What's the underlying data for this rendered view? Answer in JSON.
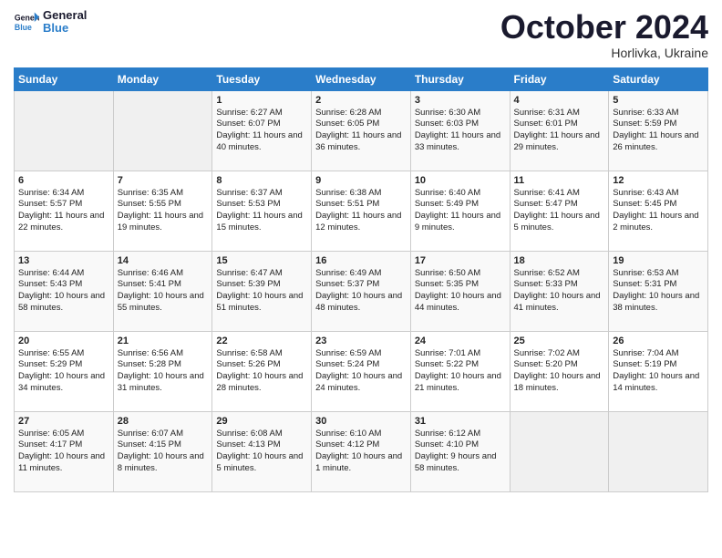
{
  "header": {
    "logo_line1": "General",
    "logo_line2": "Blue",
    "month": "October 2024",
    "location": "Horlivka, Ukraine"
  },
  "columns": [
    "Sunday",
    "Monday",
    "Tuesday",
    "Wednesday",
    "Thursday",
    "Friday",
    "Saturday"
  ],
  "weeks": [
    [
      {
        "day": "",
        "text": ""
      },
      {
        "day": "",
        "text": ""
      },
      {
        "day": "1",
        "text": "Sunrise: 6:27 AM\nSunset: 6:07 PM\nDaylight: 11 hours and 40 minutes."
      },
      {
        "day": "2",
        "text": "Sunrise: 6:28 AM\nSunset: 6:05 PM\nDaylight: 11 hours and 36 minutes."
      },
      {
        "day": "3",
        "text": "Sunrise: 6:30 AM\nSunset: 6:03 PM\nDaylight: 11 hours and 33 minutes."
      },
      {
        "day": "4",
        "text": "Sunrise: 6:31 AM\nSunset: 6:01 PM\nDaylight: 11 hours and 29 minutes."
      },
      {
        "day": "5",
        "text": "Sunrise: 6:33 AM\nSunset: 5:59 PM\nDaylight: 11 hours and 26 minutes."
      }
    ],
    [
      {
        "day": "6",
        "text": "Sunrise: 6:34 AM\nSunset: 5:57 PM\nDaylight: 11 hours and 22 minutes."
      },
      {
        "day": "7",
        "text": "Sunrise: 6:35 AM\nSunset: 5:55 PM\nDaylight: 11 hours and 19 minutes."
      },
      {
        "day": "8",
        "text": "Sunrise: 6:37 AM\nSunset: 5:53 PM\nDaylight: 11 hours and 15 minutes."
      },
      {
        "day": "9",
        "text": "Sunrise: 6:38 AM\nSunset: 5:51 PM\nDaylight: 11 hours and 12 minutes."
      },
      {
        "day": "10",
        "text": "Sunrise: 6:40 AM\nSunset: 5:49 PM\nDaylight: 11 hours and 9 minutes."
      },
      {
        "day": "11",
        "text": "Sunrise: 6:41 AM\nSunset: 5:47 PM\nDaylight: 11 hours and 5 minutes."
      },
      {
        "day": "12",
        "text": "Sunrise: 6:43 AM\nSunset: 5:45 PM\nDaylight: 11 hours and 2 minutes."
      }
    ],
    [
      {
        "day": "13",
        "text": "Sunrise: 6:44 AM\nSunset: 5:43 PM\nDaylight: 10 hours and 58 minutes."
      },
      {
        "day": "14",
        "text": "Sunrise: 6:46 AM\nSunset: 5:41 PM\nDaylight: 10 hours and 55 minutes."
      },
      {
        "day": "15",
        "text": "Sunrise: 6:47 AM\nSunset: 5:39 PM\nDaylight: 10 hours and 51 minutes."
      },
      {
        "day": "16",
        "text": "Sunrise: 6:49 AM\nSunset: 5:37 PM\nDaylight: 10 hours and 48 minutes."
      },
      {
        "day": "17",
        "text": "Sunrise: 6:50 AM\nSunset: 5:35 PM\nDaylight: 10 hours and 44 minutes."
      },
      {
        "day": "18",
        "text": "Sunrise: 6:52 AM\nSunset: 5:33 PM\nDaylight: 10 hours and 41 minutes."
      },
      {
        "day": "19",
        "text": "Sunrise: 6:53 AM\nSunset: 5:31 PM\nDaylight: 10 hours and 38 minutes."
      }
    ],
    [
      {
        "day": "20",
        "text": "Sunrise: 6:55 AM\nSunset: 5:29 PM\nDaylight: 10 hours and 34 minutes."
      },
      {
        "day": "21",
        "text": "Sunrise: 6:56 AM\nSunset: 5:28 PM\nDaylight: 10 hours and 31 minutes."
      },
      {
        "day": "22",
        "text": "Sunrise: 6:58 AM\nSunset: 5:26 PM\nDaylight: 10 hours and 28 minutes."
      },
      {
        "day": "23",
        "text": "Sunrise: 6:59 AM\nSunset: 5:24 PM\nDaylight: 10 hours and 24 minutes."
      },
      {
        "day": "24",
        "text": "Sunrise: 7:01 AM\nSunset: 5:22 PM\nDaylight: 10 hours and 21 minutes."
      },
      {
        "day": "25",
        "text": "Sunrise: 7:02 AM\nSunset: 5:20 PM\nDaylight: 10 hours and 18 minutes."
      },
      {
        "day": "26",
        "text": "Sunrise: 7:04 AM\nSunset: 5:19 PM\nDaylight: 10 hours and 14 minutes."
      }
    ],
    [
      {
        "day": "27",
        "text": "Sunrise: 6:05 AM\nSunset: 4:17 PM\nDaylight: 10 hours and 11 minutes."
      },
      {
        "day": "28",
        "text": "Sunrise: 6:07 AM\nSunset: 4:15 PM\nDaylight: 10 hours and 8 minutes."
      },
      {
        "day": "29",
        "text": "Sunrise: 6:08 AM\nSunset: 4:13 PM\nDaylight: 10 hours and 5 minutes."
      },
      {
        "day": "30",
        "text": "Sunrise: 6:10 AM\nSunset: 4:12 PM\nDaylight: 10 hours and 1 minute."
      },
      {
        "day": "31",
        "text": "Sunrise: 6:12 AM\nSunset: 4:10 PM\nDaylight: 9 hours and 58 minutes."
      },
      {
        "day": "",
        "text": ""
      },
      {
        "day": "",
        "text": ""
      }
    ]
  ]
}
